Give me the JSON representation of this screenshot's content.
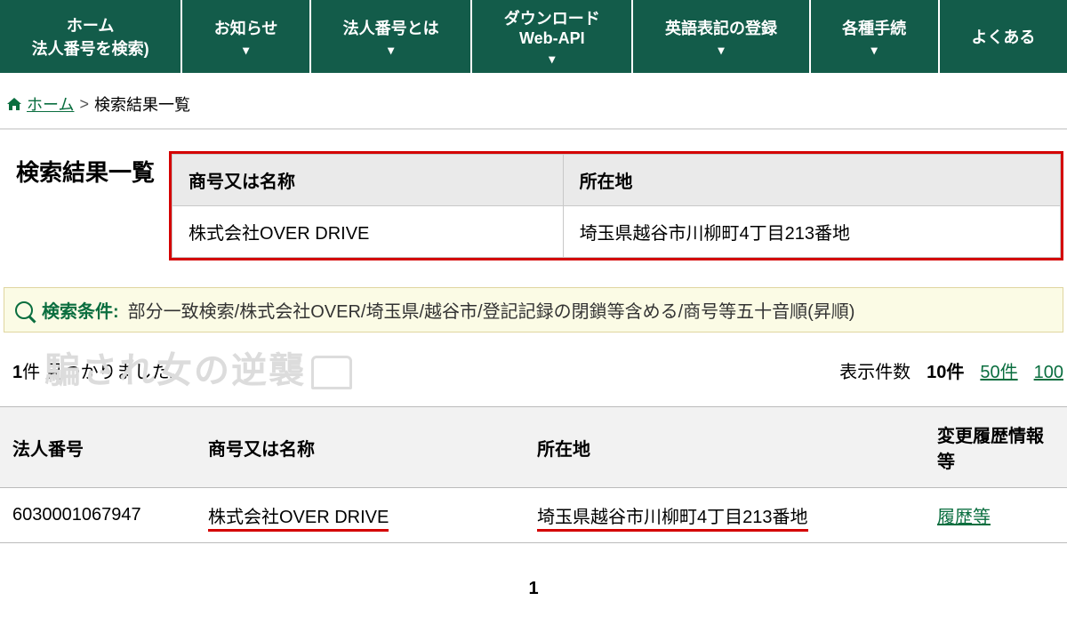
{
  "nav": [
    {
      "line1": "ホーム",
      "line2": "法人番号を検索)",
      "chev": false
    },
    {
      "line1": "お知らせ",
      "line2": "",
      "chev": true
    },
    {
      "line1": "法人番号とは",
      "line2": "",
      "chev": true
    },
    {
      "line1": "ダウンロード",
      "line2": "Web-API",
      "chev": true
    },
    {
      "line1": "英語表記の登録",
      "line2": "",
      "chev": true
    },
    {
      "line1": "各種手続",
      "line2": "",
      "chev": true
    },
    {
      "line1": "よくある",
      "line2": "",
      "chev": false
    }
  ],
  "breadcrumb": {
    "home": "ホーム",
    "sep": ">",
    "current": "検索結果一覧"
  },
  "page_title": "検索結果一覧",
  "criteria_table": {
    "headers": [
      "商号又は名称",
      "所在地"
    ],
    "row": [
      "株式会社OVER DRIVE",
      "埼玉県越谷市川柳町4丁目213番地"
    ]
  },
  "condition": {
    "label": "検索条件:",
    "text": "部分一致検索/株式会社OVER/埼玉県/越谷市/登記記録の閉鎖等含める/商号等五十音順(昇順)"
  },
  "meta": {
    "count_text_pre": "",
    "count_value": "1",
    "count_text_post": "件 見つかりました。",
    "perpage_label": "表示件数",
    "perpage_current": "10件",
    "perpage_links": [
      "50件",
      "100"
    ]
  },
  "results": {
    "headers": [
      "法人番号",
      "商号又は名称",
      "所在地",
      "変更履歴情報等"
    ],
    "rows": [
      {
        "num": "6030001067947",
        "name": "株式会社OVER DRIVE",
        "addr": "埼玉県越谷市川柳町4丁目213番地",
        "history": "履歴等"
      }
    ]
  },
  "pager": {
    "current": "1"
  },
  "watermark": "騙され女の逆襲"
}
